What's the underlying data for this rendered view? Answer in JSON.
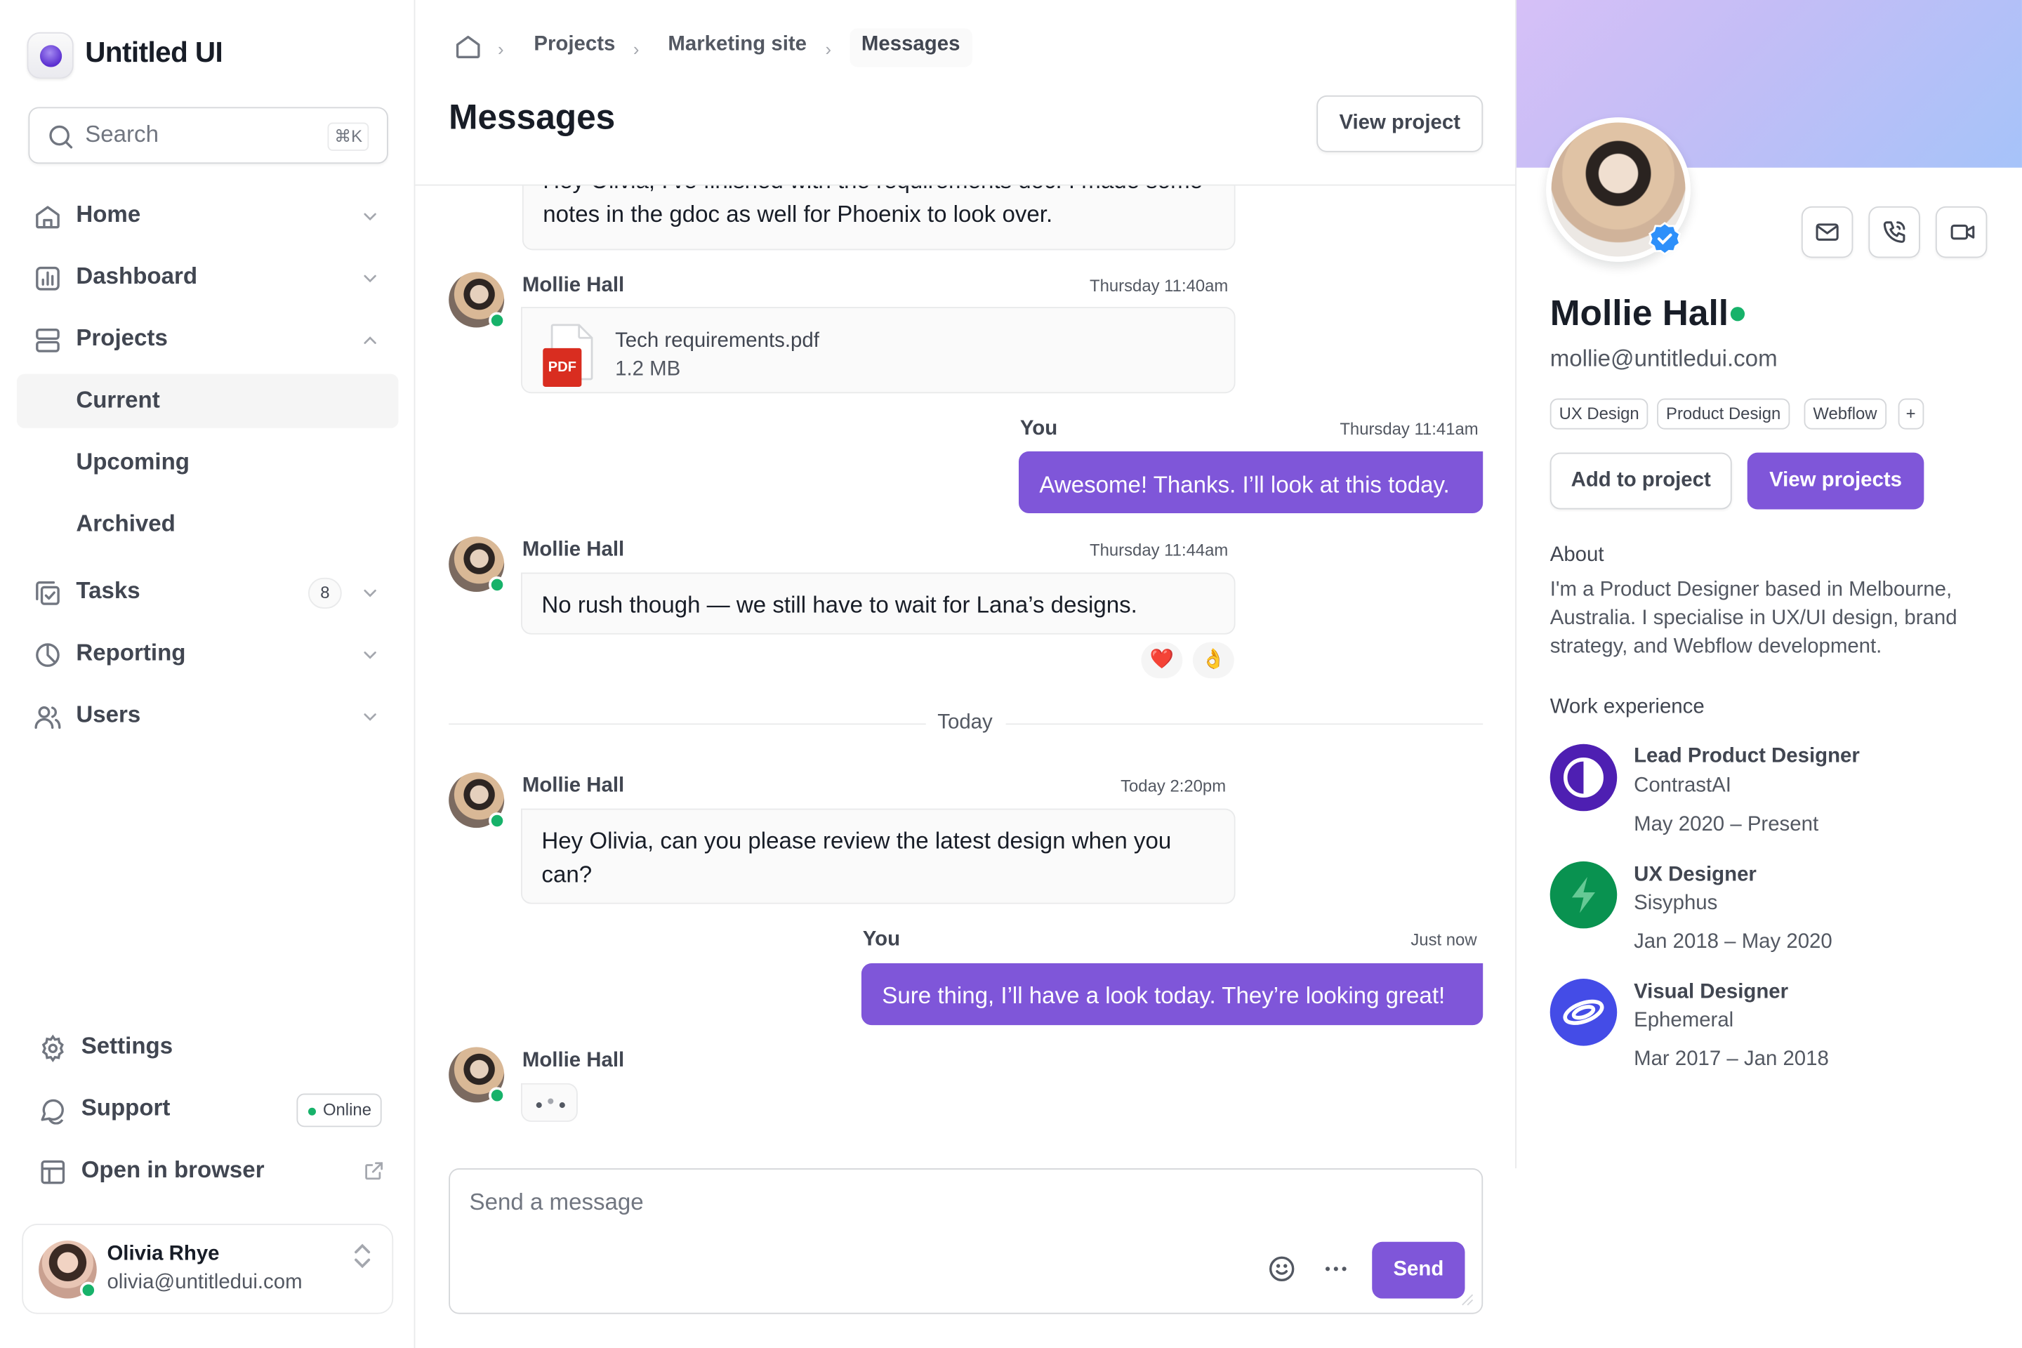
{
  "brand": {
    "name": "Untitled UI"
  },
  "search": {
    "placeholder": "Search",
    "shortcut": "⌘K"
  },
  "nav": {
    "home": "Home",
    "dashboard": "Dashboard",
    "projects": "Projects",
    "projects_sub": [
      "Current",
      "Upcoming",
      "Archived"
    ],
    "tasks": "Tasks",
    "tasks_count": "8",
    "reporting": "Reporting",
    "users": "Users",
    "settings": "Settings",
    "support": "Support",
    "support_status": "Online",
    "open_browser": "Open in browser"
  },
  "account": {
    "name": "Olivia Rhye",
    "email": "olivia@untitledui.com"
  },
  "breadcrumb": [
    "Projects",
    "Marketing site",
    "Messages"
  ],
  "header": {
    "title": "Messages",
    "view_project": "View project"
  },
  "messages": {
    "m0_text": "Hey Olivia, I've finished with the requirements doc! I made some notes in the gdoc as well for Phoenix to look over.",
    "m1_name": "Mollie Hall",
    "m1_time": "Thursday 11:40am",
    "m1_file": "Tech requirements.pdf",
    "m1_size": "1.2 MB",
    "m1_ext": "PDF",
    "m2_name": "You",
    "m2_time": "Thursday 11:41am",
    "m2_text": "Awesome! Thanks. I’ll look at this today.",
    "m3_name": "Mollie Hall",
    "m3_time": "Thursday 11:44am",
    "m3_text": "No rush though — we still have to wait for Lana’s designs.",
    "m3_reactions": [
      "❤️",
      "👌"
    ],
    "divider": "Today",
    "m4_name": "Mollie Hall",
    "m4_time": "Today 2:20pm",
    "m4_text": "Hey Olivia, can you please review the latest design when you can?",
    "m5_name": "You",
    "m5_time": "Just now",
    "m5_text": "Sure thing, I’ll have a look today. They’re looking great!",
    "m6_name": "Mollie Hall"
  },
  "composer": {
    "placeholder": "Send a message",
    "send": "Send"
  },
  "profile": {
    "name": "Mollie Hall",
    "email": "mollie@untitledui.com",
    "tags": [
      "UX Design",
      "Product Design",
      "Webflow",
      "+"
    ],
    "add_to_project": "Add to project",
    "view_projects": "View projects",
    "about_label": "About",
    "about_text": "I'm a Product Designer based in Melbourne, Australia. I specialise in UX/UI design, brand strategy, and Webflow development.",
    "work_label": "Work experience",
    "experience": [
      {
        "title": "Lead Product Designer",
        "company": "ContrastAI",
        "dates": "May 2020 – Present"
      },
      {
        "title": "UX Designer",
        "company": "Sisyphus",
        "dates": "Jan 2018 – May 2020"
      },
      {
        "title": "Visual Designer",
        "company": "Ephemeral",
        "dates": "Mar 2017 – Jan 2018"
      }
    ]
  },
  "colors": {
    "accent": "#7f56d9",
    "online": "#17b26a",
    "pdf": "#d92d20"
  }
}
